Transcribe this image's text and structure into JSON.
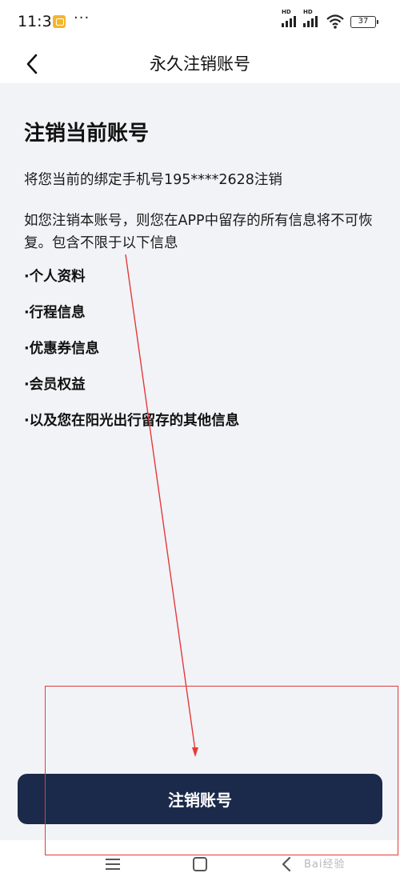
{
  "status_bar": {
    "time": "11:31",
    "app_icon": "notification-app-icon",
    "more_dots": "···",
    "signal_1_label": "HD",
    "signal_2_label": "HD",
    "wifi_icon": "wifi-icon",
    "battery_level": "37"
  },
  "nav": {
    "back_icon": "chevron-left-icon",
    "title": "永久注销账号"
  },
  "content": {
    "heading": "注销当前账号",
    "phone_line": "将您当前的绑定手机号195****2628注销",
    "warning": "如您注销本账号，则您在APP中留存的所有信息将不可恢复。包含不限于以下信息",
    "items": [
      "·个人资料",
      "·行程信息",
      "·优惠券信息",
      "·会员权益",
      "·以及您在阳光出行留存的其他信息"
    ]
  },
  "actions": {
    "delete_account_label": "注销账号"
  },
  "system_nav": {
    "menu_icon": "menu-icon",
    "home_icon": "home-square-icon",
    "back_icon": "back-triangle-icon"
  },
  "watermark": {
    "text": "Bai经验"
  },
  "colors": {
    "background": "#f2f3f7",
    "primary_button": "#1b2a4a",
    "annotation_red": "#e43a3a"
  }
}
